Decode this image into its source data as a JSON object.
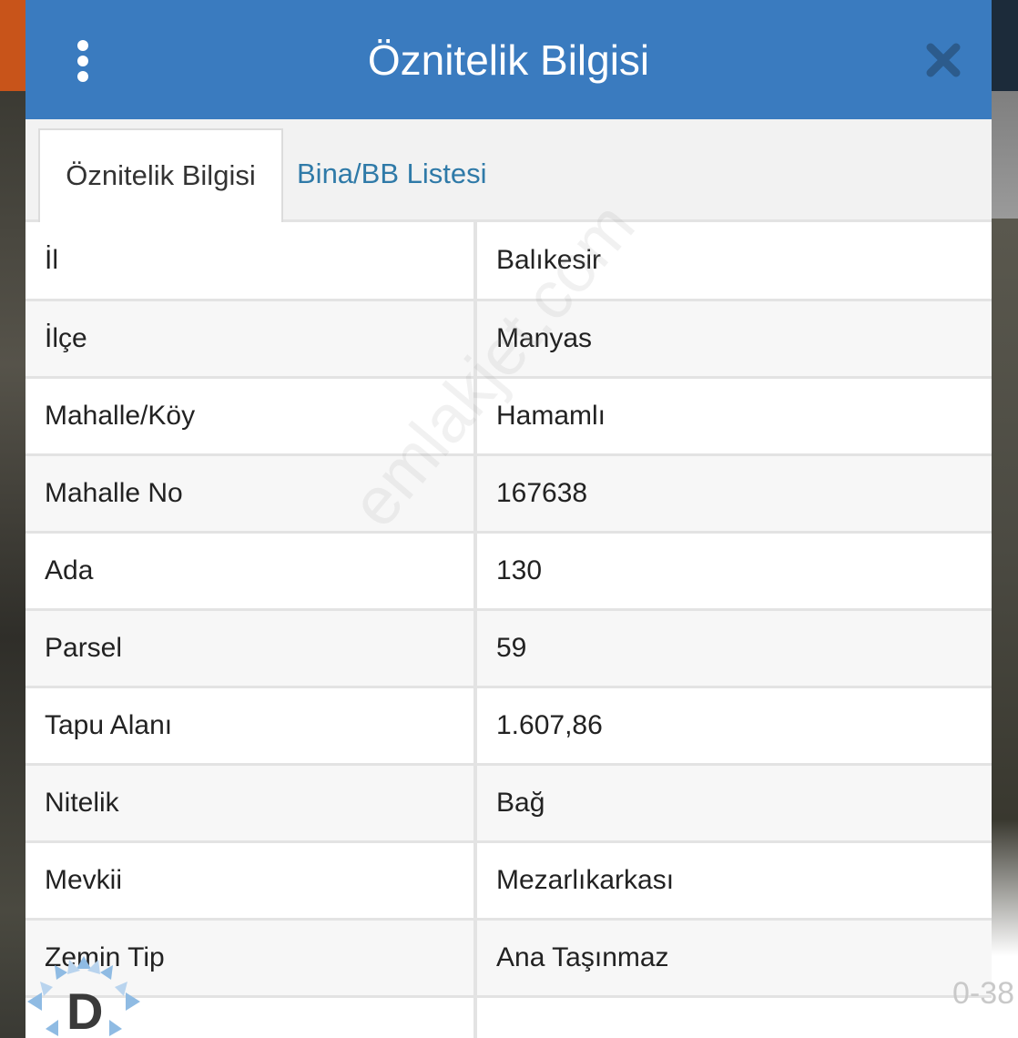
{
  "header": {
    "title": "Öznitelik Bilgisi",
    "menu_icon": "vertical-dots-icon",
    "close_icon": "close-icon",
    "color": "#3a7bbf"
  },
  "tabs": [
    {
      "label": "Öznitelik Bilgisi",
      "active": true
    },
    {
      "label": "Bina/BB Listesi",
      "active": false
    }
  ],
  "attributes": [
    {
      "key": "İl",
      "value": "Balıkesir"
    },
    {
      "key": "İlçe",
      "value": "Manyas"
    },
    {
      "key": "Mahalle/Köy",
      "value": "Hamamlı"
    },
    {
      "key": "Mahalle No",
      "value": "167638"
    },
    {
      "key": "Ada",
      "value": "130"
    },
    {
      "key": "Parsel",
      "value": "59"
    },
    {
      "key": "Tapu Alanı",
      "value": "1.607,86"
    },
    {
      "key": "Nitelik",
      "value": "Bağ"
    },
    {
      "key": "Mevkii",
      "value": "Mezarlıkarkası"
    },
    {
      "key": "Zemin Tip",
      "value": "Ana Taşınmaz"
    },
    {
      "key": "",
      "value": ""
    }
  ],
  "watermark": "emlakjet.com",
  "logo_letter": "D",
  "corner_text": "0-38"
}
